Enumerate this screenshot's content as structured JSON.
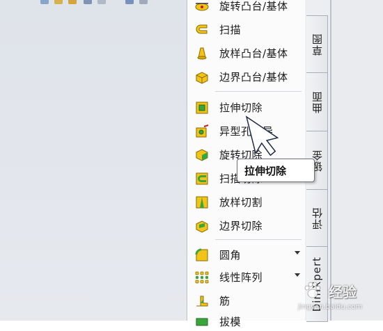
{
  "menu": {
    "items": [
      {
        "label": "旋转凸台/基体",
        "icon": "revolve-boss-icon"
      },
      {
        "label": "扫描",
        "icon": "sweep-icon"
      },
      {
        "label": "放样凸台/基体",
        "icon": "loft-boss-icon"
      },
      {
        "label": "边界凸台/基体",
        "icon": "boundary-boss-icon"
      },
      {
        "label": "拉伸切除",
        "icon": "extruded-cut-icon"
      },
      {
        "label": "异型孔向导",
        "icon": "hole-wizard-icon"
      },
      {
        "label": "旋转切除",
        "icon": "revolved-cut-icon"
      },
      {
        "label": "扫描切除",
        "icon": "swept-cut-icon"
      },
      {
        "label": "放样切割",
        "icon": "lofted-cut-icon"
      },
      {
        "label": "边界切除",
        "icon": "boundary-cut-icon"
      },
      {
        "label": "圆角",
        "icon": "fillet-icon"
      },
      {
        "label": "线性阵列",
        "icon": "linear-pattern-icon"
      },
      {
        "label": "筋",
        "icon": "rib-icon"
      },
      {
        "label": "拔模",
        "icon": "draft-icon"
      }
    ]
  },
  "tabs": [
    {
      "label": "草图"
    },
    {
      "label": "曲面"
    },
    {
      "label": "钣金"
    },
    {
      "label": "评估"
    },
    {
      "label": "DimXpert"
    }
  ],
  "tooltip": {
    "text": "拉伸切除"
  },
  "watermark": {
    "title": "经验",
    "url": "jingyan.baidu.com"
  },
  "colors": {
    "icon_yellow": "#f2c418",
    "icon_green": "#3aa53a",
    "menu_bg": "#fbfbfc",
    "pane_bg": "#e3e6eb"
  }
}
